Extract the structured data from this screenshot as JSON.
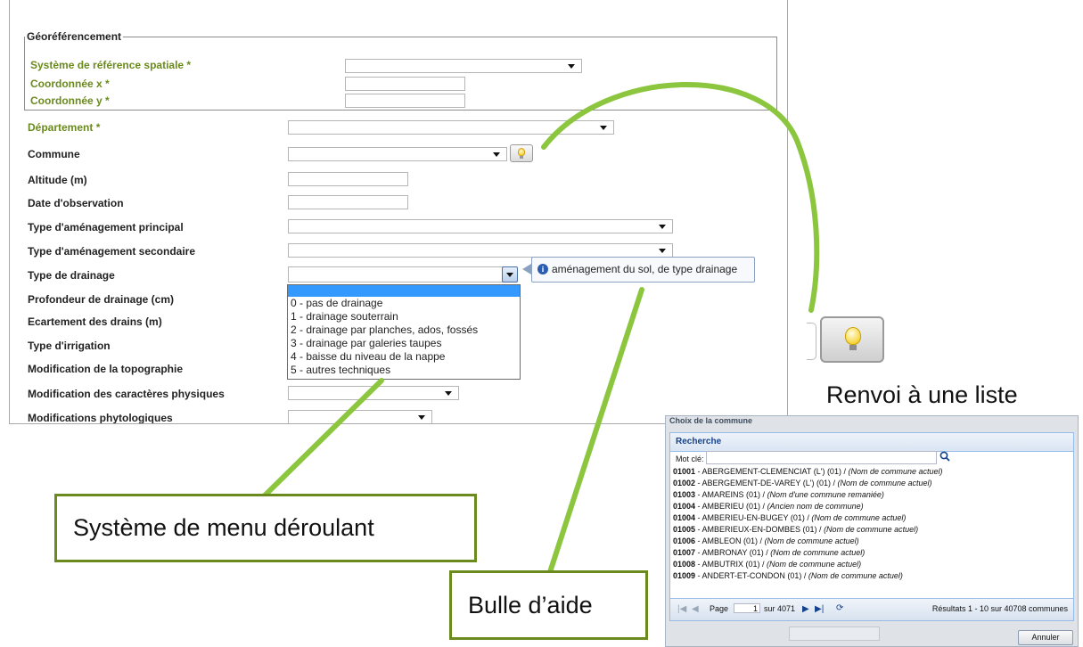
{
  "form": {
    "fieldset_legend": "Géoréférencement",
    "labels": {
      "srs": "Système de référence spatiale *",
      "cx": "Coordonnée x *",
      "cy": "Coordonnée y *",
      "departement": "Département *",
      "commune": "Commune",
      "altitude": "Altitude (m)",
      "date_obs": "Date d'observation",
      "amenagement_principal": "Type d'aménagement principal",
      "amenagement_secondaire": "Type d'aménagement secondaire",
      "drainage": "Type de drainage",
      "profondeur_drainage": "Profondeur de drainage (cm)",
      "ecartement": "Ecartement des drains (m)",
      "irrigation": "Type d'irrigation",
      "topographie": "Modification de la topographie",
      "caracteres_physiques": "Modification des caractères physiques",
      "phytologiques": "Modifications phytologiques"
    }
  },
  "dropdown": {
    "options": [
      "0 - pas de drainage",
      "1 - drainage souterrain",
      "2 - drainage par planches, ados, fossés",
      "3 - drainage par galeries taupes",
      "4 - baisse du niveau de la nappe",
      "5 - autres techniques"
    ]
  },
  "tooltip": {
    "text": "aménagement du sol, de type drainage",
    "icon": "info-icon"
  },
  "captions": {
    "renvoi": "Renvoi à une liste",
    "menu": "Système de menu déroulant",
    "bulle": "Bulle d’aide"
  },
  "commune_window": {
    "title": "Choix de la commune",
    "panel_title": "Recherche",
    "keyword_label": "Mot clé:",
    "rows": [
      {
        "code": "01001",
        "name": " - ABERGEMENT-CLEMENCIAT (L') (01) / ",
        "note": "(Nom de commune actuel)"
      },
      {
        "code": "01002",
        "name": " - ABERGEMENT-DE-VAREY (L') (01) / ",
        "note": "(Nom de commune actuel)"
      },
      {
        "code": "01003",
        "name": " - AMAREINS (01) / ",
        "note": "(Nom d'une commune remaniée)"
      },
      {
        "code": "01004",
        "name": " - AMBERIEU (01) / ",
        "note": "(Ancien nom de commune)"
      },
      {
        "code": "01004",
        "name": " - AMBERIEU-EN-BUGEY (01) / ",
        "note": "(Nom de commune actuel)"
      },
      {
        "code": "01005",
        "name": " - AMBERIEUX-EN-DOMBES (01) / ",
        "note": "(Nom de commune actuel)"
      },
      {
        "code": "01006",
        "name": " - AMBLEON (01) / ",
        "note": "(Nom de commune actuel)"
      },
      {
        "code": "01007",
        "name": " - AMBRONAY (01) / ",
        "note": "(Nom de commune actuel)"
      },
      {
        "code": "01008",
        "name": " - AMBUTRIX (01) / ",
        "note": "(Nom de commune actuel)"
      },
      {
        "code": "01009",
        "name": " - ANDERT-ET-CONDON (01) / ",
        "note": "(Nom de commune actuel)"
      }
    ],
    "pager": {
      "page_label": "Page",
      "page_value": "1",
      "of_label": "sur 4071",
      "results": "Résultats 1 - 10 sur 40708 communes"
    },
    "cancel_label": "Annuler"
  },
  "colors": {
    "accent_green": "#6b8a1e",
    "highlight_blue": "#3399ff",
    "callout_green": "#8cc63f"
  }
}
